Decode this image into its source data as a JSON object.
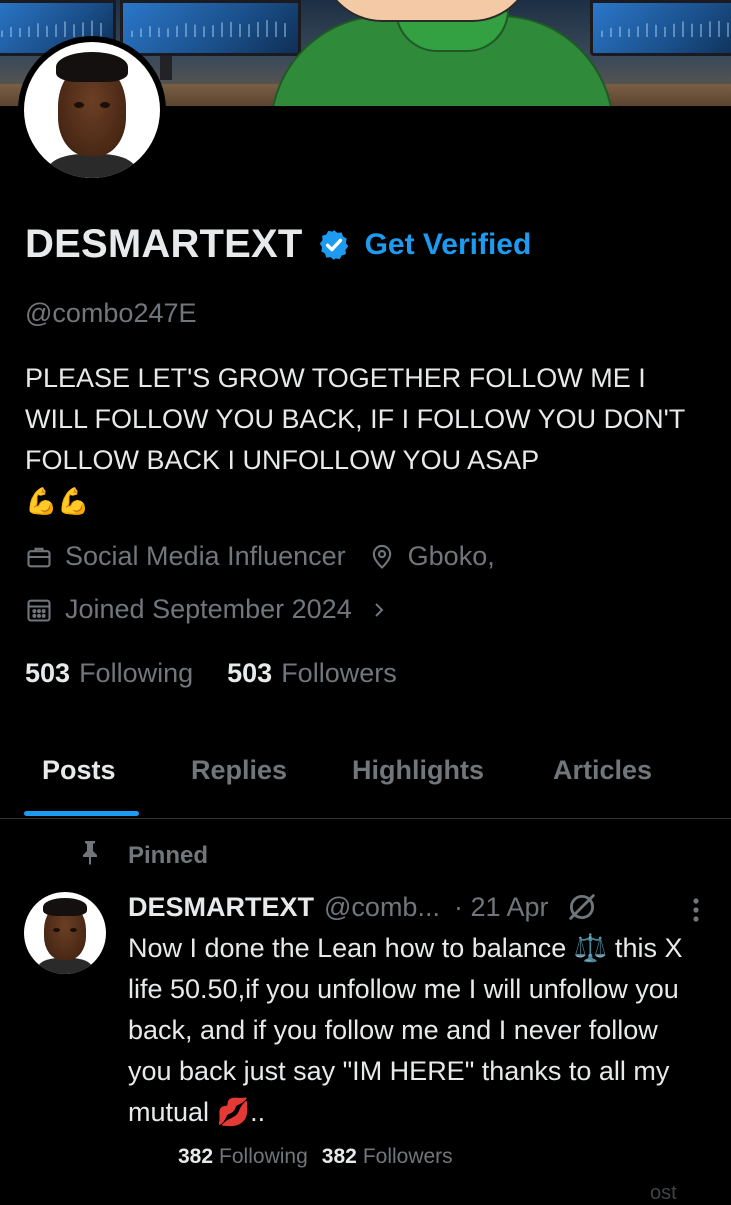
{
  "profile": {
    "display_name": "DESMARTEXT",
    "get_verified_label": "Get Verified",
    "handle": "@combo247E",
    "bio_text": "PLEASE LET'S GROW TOGETHER FOLLOW ME I WILL FOLLOW YOU BACK, IF I FOLLOW YOU DON'T FOLLOW BACK I UNFOLLOW YOU ASAP",
    "bio_emoji": "💪💪",
    "category": "Social Media Influencer",
    "location": "Gboko,",
    "joined": "Joined September 2024",
    "following_count": "503",
    "following_label": "Following",
    "followers_count": "503",
    "followers_label": "Followers"
  },
  "tabs": [
    {
      "label": "Posts",
      "active": true
    },
    {
      "label": "Replies",
      "active": false
    },
    {
      "label": "Highlights",
      "active": false
    },
    {
      "label": "Articles",
      "active": false
    }
  ],
  "pinned_post": {
    "pinned_label": "Pinned",
    "author_name": "DESMARTEXT",
    "author_handle": "@comb...",
    "date": "· 21 Apr",
    "text": "Now I done the Lean how to balance ⚖️ this X life 50.50,if you unfollow me I will unfollow you back, and if you follow me and I never follow you back just say \"IM HERE\" thanks to all my mutual 💋..",
    "following_count": "382",
    "following_label": "Following",
    "followers_count": "382",
    "followers_label": "Followers",
    "cut_off_text": "ost"
  },
  "colors": {
    "background": "#000000",
    "text_primary": "#e7e9ea",
    "text_secondary": "#71767b",
    "accent": "#1d9bf0",
    "divider": "#2f3336"
  },
  "icons": [
    "verified-badge-icon",
    "briefcase-icon",
    "location-pin-icon",
    "calendar-icon",
    "chevron-right-icon",
    "pin-icon",
    "grok-icon",
    "more-vertical-icon"
  ]
}
